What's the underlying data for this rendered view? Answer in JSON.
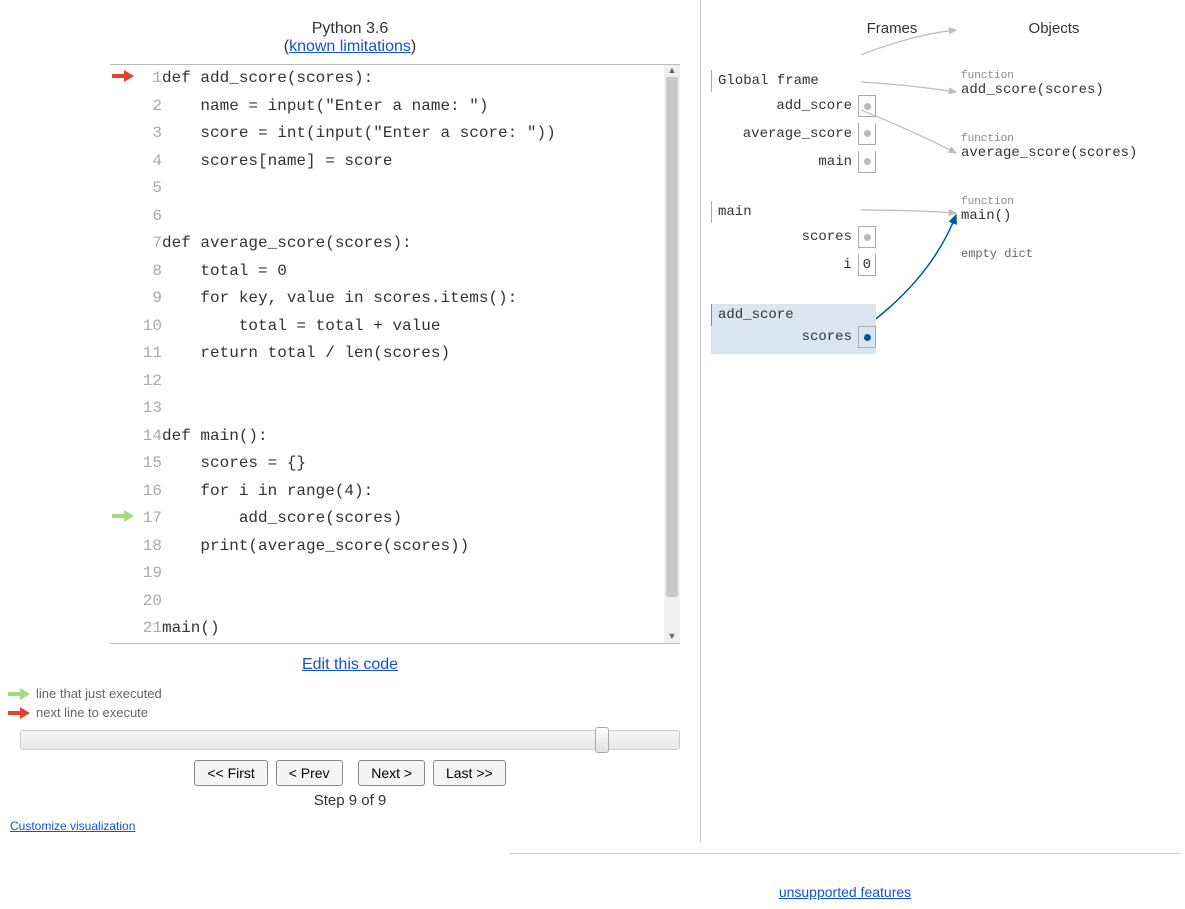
{
  "header": {
    "title_prefix": "Python 3.6",
    "limitations_label": "known limitations"
  },
  "code": {
    "lines": [
      {
        "n": 1,
        "text": "def add_score(scores):",
        "arrow": "red"
      },
      {
        "n": 2,
        "text": "    name = input(\"Enter a name: \")"
      },
      {
        "n": 3,
        "text": "    score = int(input(\"Enter a score: \"))"
      },
      {
        "n": 4,
        "text": "    scores[name] = score"
      },
      {
        "n": 5,
        "text": ""
      },
      {
        "n": 6,
        "text": ""
      },
      {
        "n": 7,
        "text": "def average_score(scores):"
      },
      {
        "n": 8,
        "text": "    total = 0"
      },
      {
        "n": 9,
        "text": "    for key, value in scores.items():"
      },
      {
        "n": 10,
        "text": "        total = total + value"
      },
      {
        "n": 11,
        "text": "    return total / len(scores)"
      },
      {
        "n": 12,
        "text": ""
      },
      {
        "n": 13,
        "text": ""
      },
      {
        "n": 14,
        "text": "def main():"
      },
      {
        "n": 15,
        "text": "    scores = {}"
      },
      {
        "n": 16,
        "text": "    for i in range(4):"
      },
      {
        "n": 17,
        "text": "        add_score(scores)",
        "arrow": "green"
      },
      {
        "n": 18,
        "text": "    print(average_score(scores))"
      },
      {
        "n": 19,
        "text": ""
      },
      {
        "n": 20,
        "text": ""
      },
      {
        "n": 21,
        "text": "main()"
      }
    ],
    "edit_label": "Edit this code"
  },
  "legend": {
    "green": "line that just executed",
    "red": "next line to execute"
  },
  "controls": {
    "first": "<< First",
    "prev": "< Prev",
    "next": "Next >",
    "last": "Last >>",
    "step_label": "Step 9 of 9"
  },
  "customize_label": "Customize visualization",
  "frames_objects": {
    "frames_header": "Frames",
    "objects_header": "Objects",
    "global": {
      "title": "Global frame",
      "vars": [
        {
          "name": "add_score"
        },
        {
          "name": "average_score"
        },
        {
          "name": "main"
        }
      ]
    },
    "main": {
      "title": "main",
      "vars": [
        {
          "name": "scores"
        },
        {
          "name": "i",
          "value": "0"
        }
      ]
    },
    "add_score": {
      "title": "add_score",
      "vars": [
        {
          "name": "scores"
        }
      ]
    },
    "objects": [
      {
        "type": "function",
        "val": "add_score(scores)"
      },
      {
        "type": "function",
        "val": "average_score(scores)"
      },
      {
        "type": "function",
        "val": "main()"
      },
      {
        "type": "",
        "val": "empty dict",
        "small": true
      }
    ]
  },
  "footer": {
    "unsupported": "unsupported features"
  }
}
